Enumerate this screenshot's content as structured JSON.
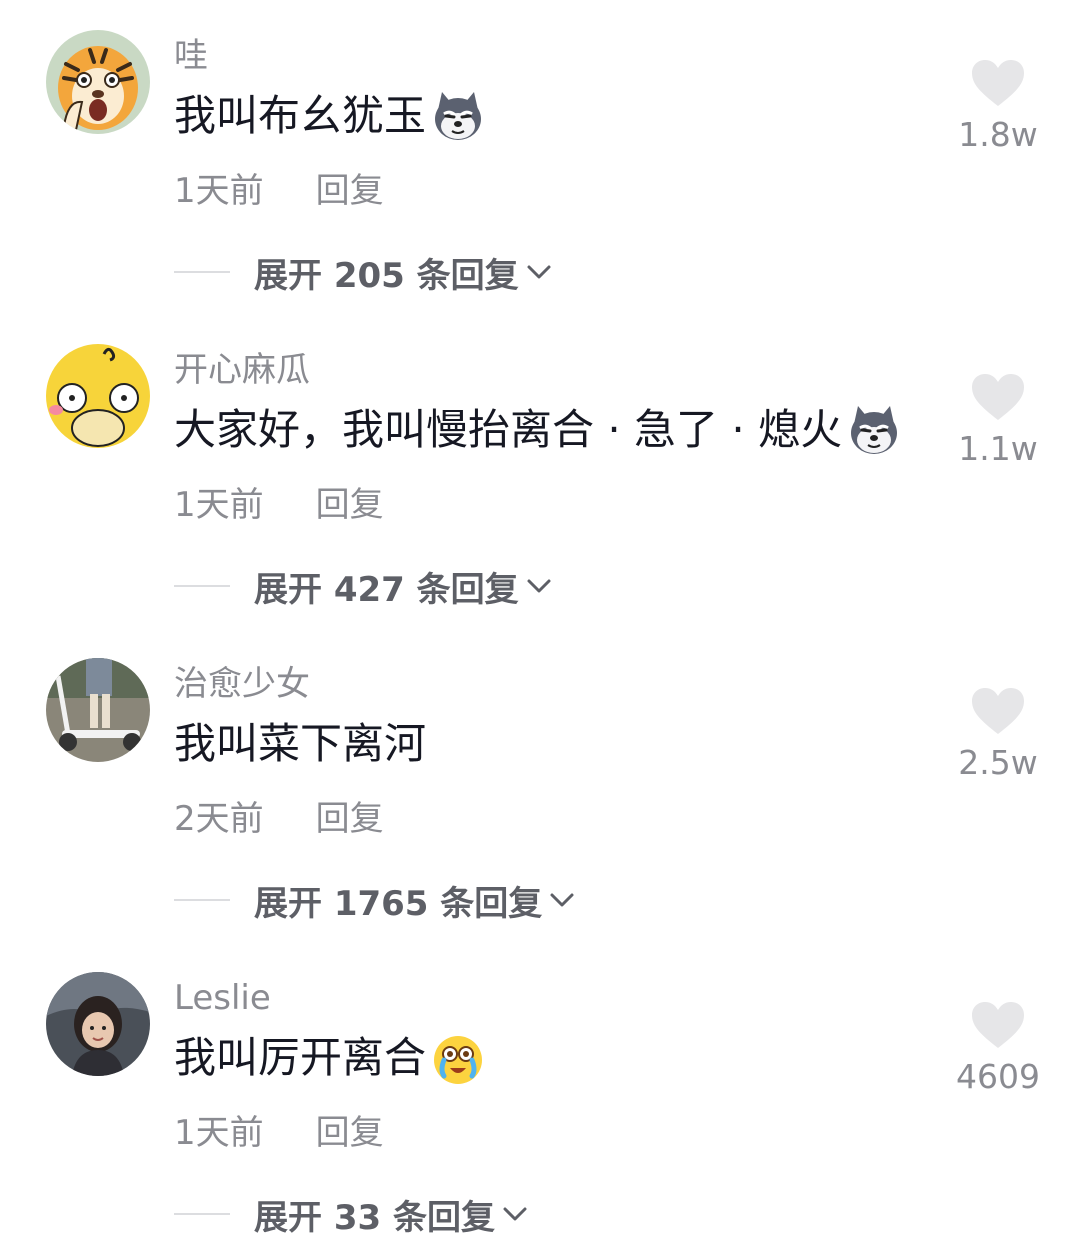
{
  "comments": [
    {
      "username": "哇",
      "text": "我叫布幺犹玉",
      "emoji": "husky-dog-emoji",
      "time": "1天前",
      "reply_label": "回复",
      "expand_label": "展开 205 条回复",
      "likes": "1.8w",
      "avatar": "tiger-cartoon-avatar"
    },
    {
      "username": "开心麻瓜",
      "text": "大家好，我叫慢抬离合 · 急了 · 熄火",
      "emoji": "husky-dog-emoji",
      "time": "1天前",
      "reply_label": "回复",
      "expand_label": "展开 427 条回复",
      "likes": "1.1w",
      "avatar": "yellow-duck-avatar"
    },
    {
      "username": "治愈少女",
      "text": "我叫菜下离河",
      "emoji": "",
      "time": "2天前",
      "reply_label": "回复",
      "expand_label": "展开 1765 条回复",
      "likes": "2.5w",
      "avatar": "scooter-photo-avatar"
    },
    {
      "username": "Leslie",
      "text": "我叫厉开离合",
      "emoji": "crying-laugh-emoji",
      "time": "1天前",
      "reply_label": "回复",
      "expand_label": "展开 33 条回复",
      "likes": "4609",
      "avatar": "girl-photo-avatar"
    }
  ],
  "colors": {
    "text_primary": "#161823",
    "text_secondary": "#8a8b91",
    "expand_text": "#5d5f66",
    "heart": "#e6e6e8"
  }
}
